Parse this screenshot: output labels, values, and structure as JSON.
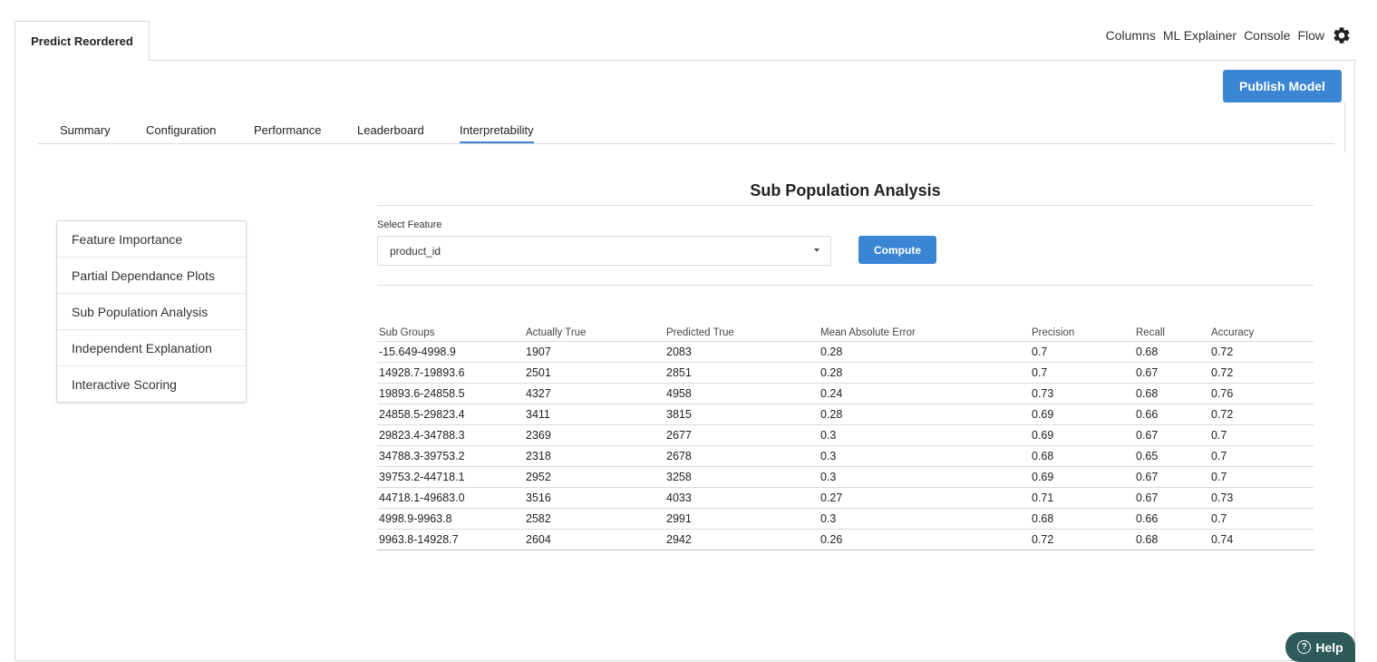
{
  "top_tab": {
    "label": "Predict Reordered"
  },
  "top_nav": {
    "items": [
      "Columns",
      "ML Explainer",
      "Console",
      "Flow"
    ]
  },
  "actions": {
    "publish_label": "Publish Model"
  },
  "sub_tabs": {
    "items": [
      "Summary",
      "Configuration",
      "Performance",
      "Leaderboard",
      "Interpretability"
    ],
    "active": "Interpretability"
  },
  "side_menu": {
    "items": [
      "Feature Importance",
      "Partial Dependance Plots",
      "Sub Population Analysis",
      "Independent Explanation",
      "Interactive Scoring"
    ]
  },
  "section": {
    "title": "Sub Population Analysis"
  },
  "select": {
    "label": "Select Feature",
    "value": "product_id"
  },
  "compute": {
    "label": "Compute"
  },
  "table": {
    "headers": [
      "Sub Groups",
      "Actually True",
      "Predicted True",
      "Mean Absolute Error",
      "Precision",
      "Recall",
      "Accuracy"
    ],
    "rows": [
      [
        "-15.649-4998.9",
        "1907",
        "2083",
        "0.28",
        "0.7",
        "0.68",
        "0.72"
      ],
      [
        "14928.7-19893.6",
        "2501",
        "2851",
        "0.28",
        "0.7",
        "0.67",
        "0.72"
      ],
      [
        "19893.6-24858.5",
        "4327",
        "4958",
        "0.24",
        "0.73",
        "0.68",
        "0.76"
      ],
      [
        "24858.5-29823.4",
        "3411",
        "3815",
        "0.28",
        "0.69",
        "0.66",
        "0.72"
      ],
      [
        "29823.4-34788.3",
        "2369",
        "2677",
        "0.3",
        "0.69",
        "0.67",
        "0.7"
      ],
      [
        "34788.3-39753.2",
        "2318",
        "2678",
        "0.3",
        "0.68",
        "0.65",
        "0.7"
      ],
      [
        "39753.2-44718.1",
        "2952",
        "3258",
        "0.3",
        "0.69",
        "0.67",
        "0.7"
      ],
      [
        "44718.1-49683.0",
        "3516",
        "4033",
        "0.27",
        "0.71",
        "0.67",
        "0.73"
      ],
      [
        "4998.9-9963.8",
        "2582",
        "2991",
        "0.3",
        "0.68",
        "0.66",
        "0.7"
      ],
      [
        "9963.8-14928.7",
        "2604",
        "2942",
        "0.26",
        "0.72",
        "0.68",
        "0.74"
      ]
    ]
  },
  "help": {
    "label": "Help"
  },
  "colors": {
    "accent": "#3a86d4",
    "help_bg": "#2f5a5a",
    "border": "#d9d9d9"
  },
  "icons": {
    "settings": "gear-icon",
    "help": "question-circle-icon",
    "dropdown": "caret-down-icon"
  }
}
